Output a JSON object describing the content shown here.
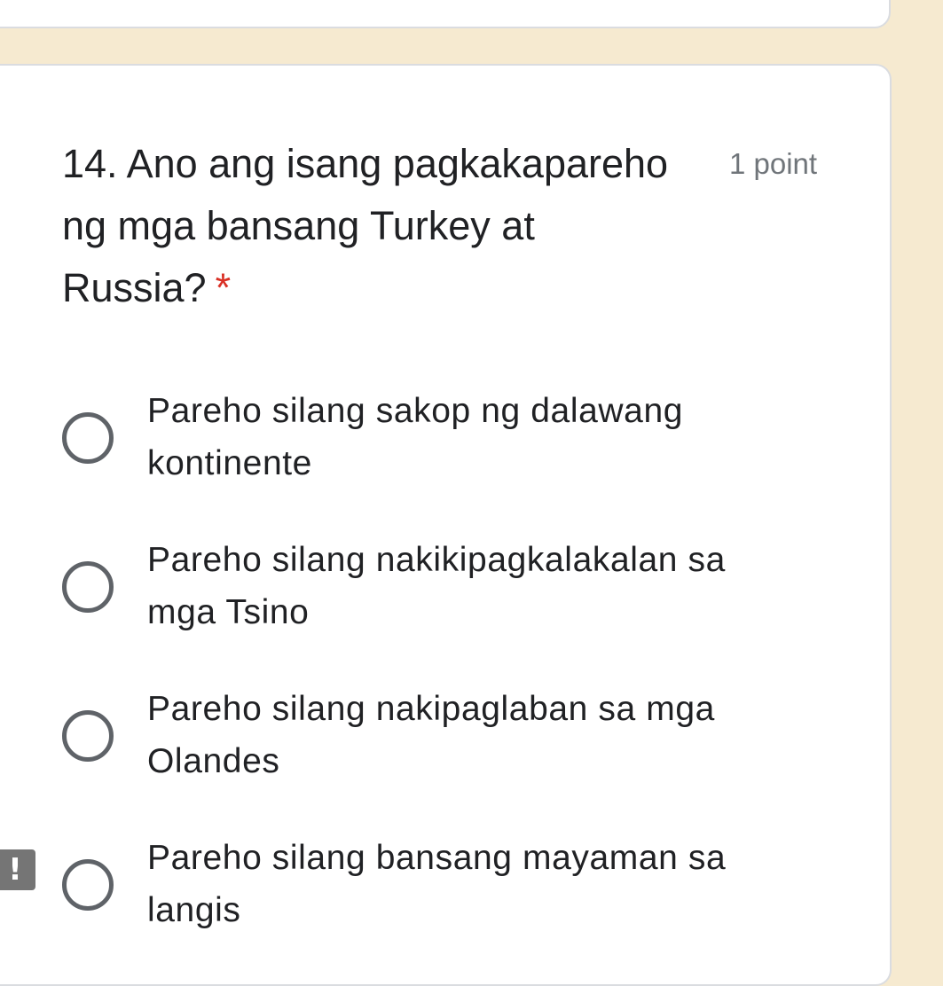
{
  "question": {
    "title_lines": [
      "14. Ano ang isang pagkakapareho",
      "ng mga bansang Turkey at",
      "Russia?"
    ],
    "required_marker": "*",
    "points": "1 point"
  },
  "options": [
    {
      "line1": "Pareho silang sakop ng dalawang",
      "line2": "kontinente"
    },
    {
      "line1": "Pareho silang nakikipagkalakalan sa",
      "line2": "mga Tsino"
    },
    {
      "line1": "Pareho silang nakipaglaban sa mga",
      "line2": "Olandes"
    },
    {
      "line1": "Pareho silang bansang mayaman sa",
      "line2": "langis"
    }
  ],
  "alert_badge": {
    "symbol": "!",
    "icon": "exclamation-icon",
    "color": "#757575"
  },
  "colors": {
    "page_background": "#f6ead0",
    "card_background": "#ffffff",
    "required": "#d93025",
    "radio_border": "#5f6368"
  }
}
